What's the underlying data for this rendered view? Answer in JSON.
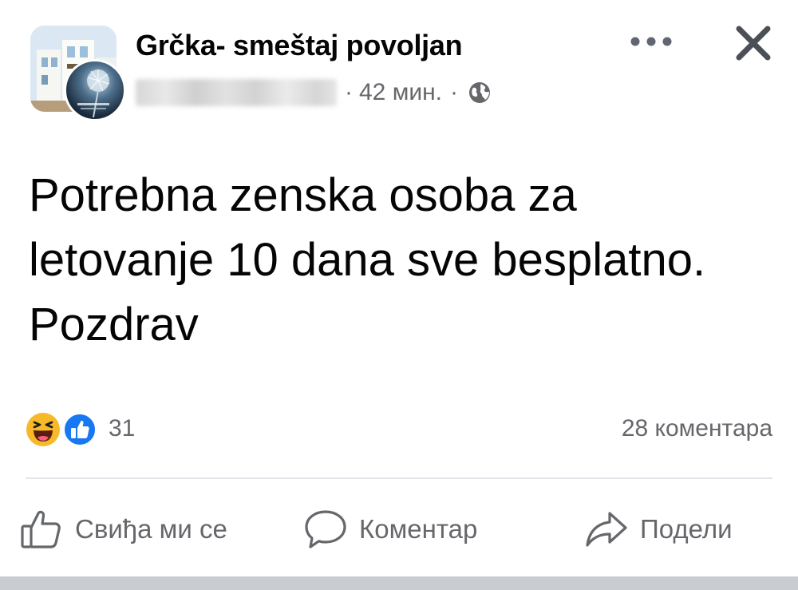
{
  "post": {
    "group_name": "Grčka- smeštaj povoljan",
    "time": "42 мин.",
    "meta_separator": "·",
    "text": "Potrebna zenska osoba za letovanje 10 dana sve besplatno. Pozdrav",
    "visibility_icon": "globe-icon",
    "header_icons": [
      "more-options-icon",
      "close-icon"
    ]
  },
  "reactions": {
    "types": [
      "haha-icon",
      "like-icon"
    ],
    "count": "31"
  },
  "comments": {
    "count_label": "28 коментара"
  },
  "actions": [
    {
      "label": "Свиђа ми се",
      "icon": "thumbs-up-icon"
    },
    {
      "label": "Коментар",
      "icon": "comment-bubble-icon"
    },
    {
      "label": "Подели",
      "icon": "share-arrow-icon"
    }
  ],
  "colors": {
    "text": "#050505",
    "secondary_text": "#65676b",
    "divider": "#e4e6eb",
    "like_blue": "#1877f2",
    "haha_yellow": "#f7b928"
  }
}
